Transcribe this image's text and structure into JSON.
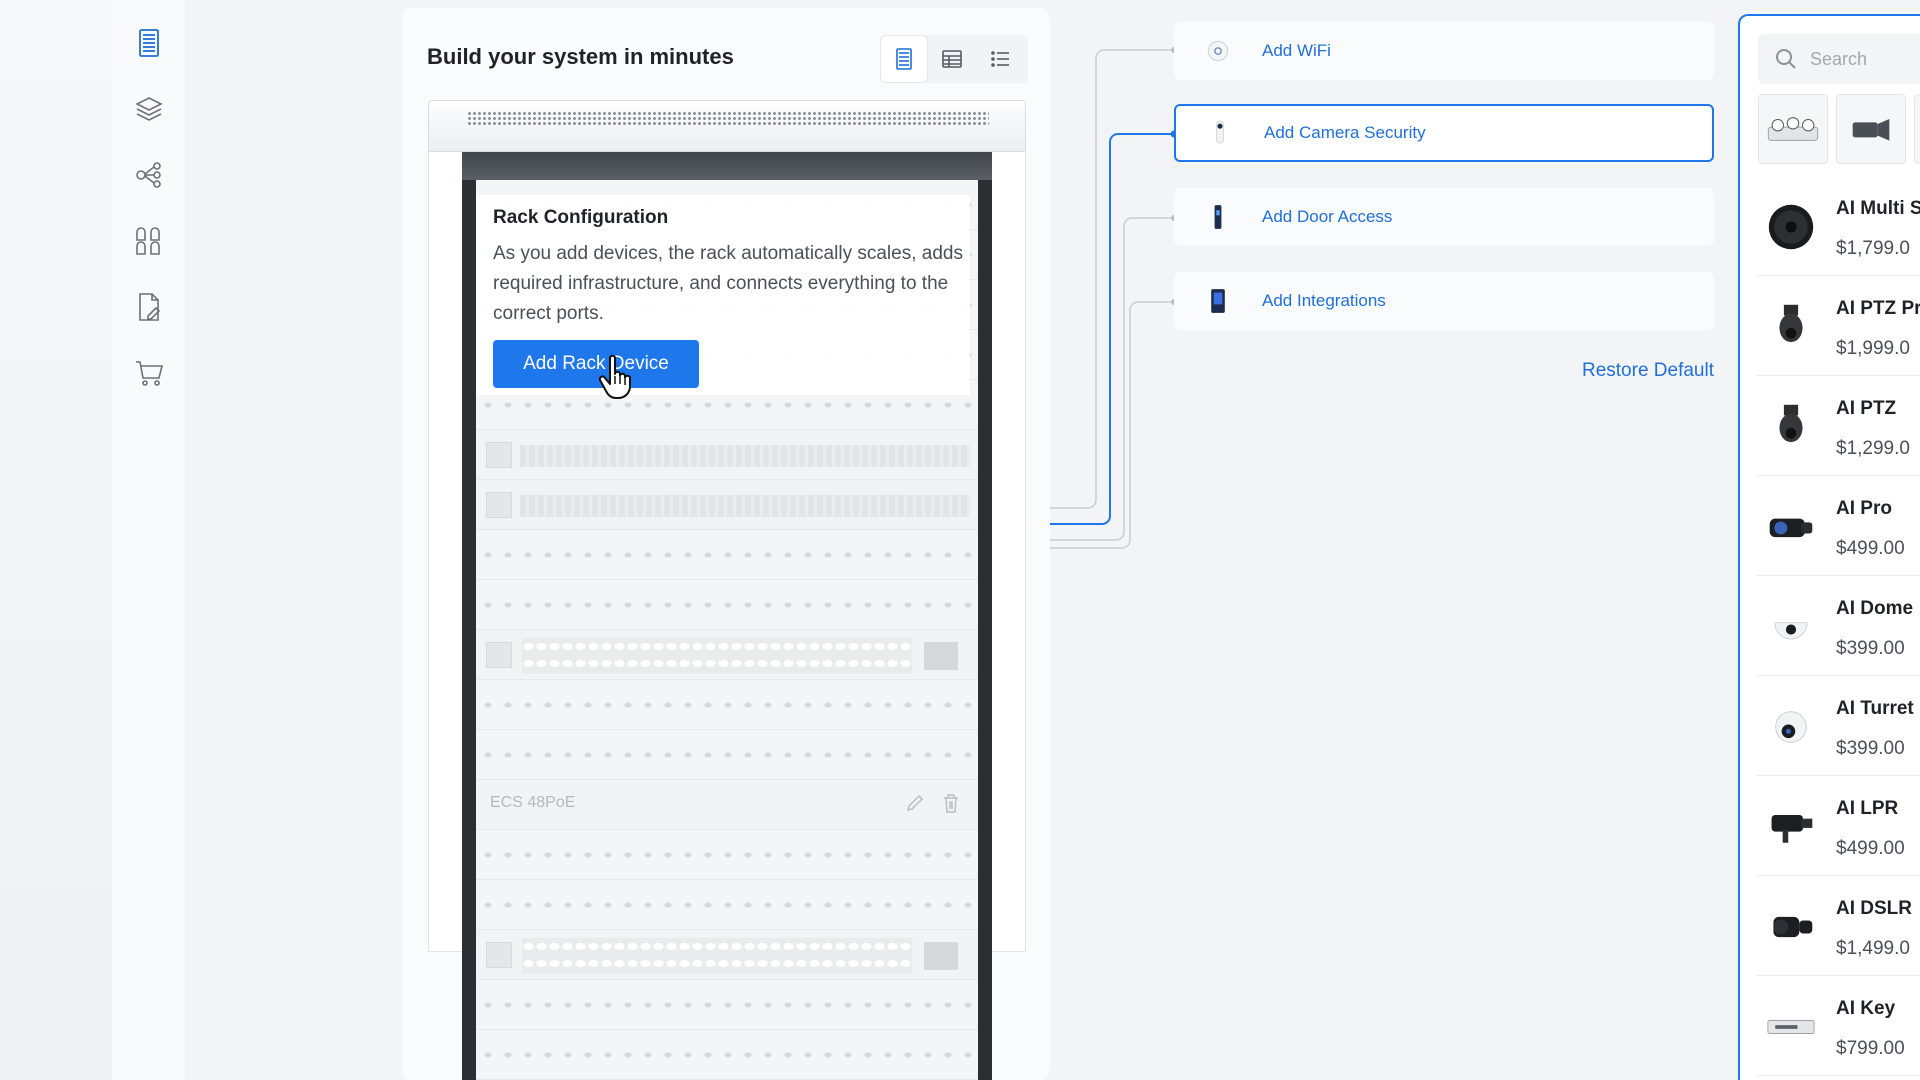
{
  "builder": {
    "title": "Build your system in minutes"
  },
  "rack_card": {
    "title": "Rack Configuration",
    "description": "As you add devices, the rack automatically scales, adds required infrastructure, and connects everything to the correct ports.",
    "button_label": "Add Rack Device"
  },
  "rack_unit_label": "ECS 48PoE",
  "add_items": [
    {
      "label": "Add WiFi"
    },
    {
      "label": "Add Camera Security"
    },
    {
      "label": "Add Door Access"
    },
    {
      "label": "Add Integrations"
    }
  ],
  "restore_label": "Restore Default",
  "search": {
    "placeholder": "Search"
  },
  "products": [
    {
      "name": "AI Multi S",
      "price": "$1,799.0"
    },
    {
      "name": "AI PTZ Pr",
      "price": "$1,999.0"
    },
    {
      "name": "AI PTZ",
      "price": "$1,299.0"
    },
    {
      "name": "AI Pro",
      "price": "$499.00"
    },
    {
      "name": "AI Dome",
      "price": "$399.00"
    },
    {
      "name": "AI Turret",
      "price": "$399.00"
    },
    {
      "name": "AI LPR",
      "price": "$499.00"
    },
    {
      "name": "AI DSLR",
      "price": "$1,499.0"
    },
    {
      "name": "AI Key",
      "price": "$799.00"
    }
  ],
  "colors": {
    "accent": "#1f77ec",
    "link": "#1f6fd6"
  }
}
